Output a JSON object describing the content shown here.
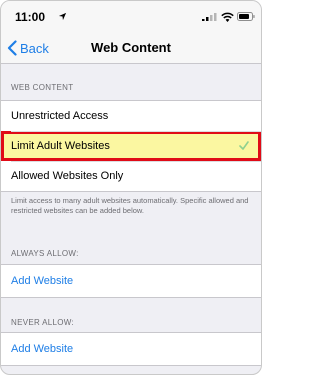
{
  "status_bar": {
    "time": "11:00"
  },
  "nav": {
    "back_label": "Back",
    "title": "Web Content"
  },
  "web_content": {
    "header": "WEB CONTENT",
    "options": [
      {
        "label": "Unrestricted Access",
        "selected": false
      },
      {
        "label": "Limit Adult Websites",
        "selected": true
      },
      {
        "label": "Allowed Websites Only",
        "selected": false
      }
    ],
    "footer": "Limit access to many adult websites automatically. Specific allowed and restricted websites can be added below."
  },
  "always_allow": {
    "header": "ALWAYS ALLOW:",
    "add_label": "Add Website"
  },
  "never_allow": {
    "header": "NEVER ALLOW:",
    "add_label": "Add Website"
  },
  "colors": {
    "accent": "#1e7ee6",
    "highlight_fill": "#fbf7a1",
    "highlight_border": "#e00b17",
    "checkmark": "#8fd18f"
  },
  "icons": [
    "location-arrow-icon",
    "signal-icon",
    "wifi-icon",
    "battery-icon",
    "back-chevron-icon",
    "checkmark-icon"
  ]
}
